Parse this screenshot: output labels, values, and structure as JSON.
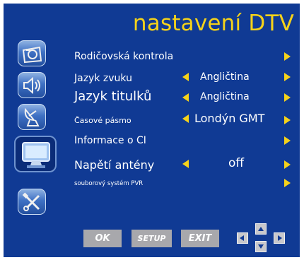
{
  "title": "nastavení DTV",
  "colors": {
    "panel": "#103a94",
    "accent": "#f5d21a",
    "text": "#ffffff",
    "button": "#a8a8ac"
  },
  "sidebar": {
    "icons": [
      "camera-icon",
      "speaker-icon",
      "satellite-icon",
      "tv-monitor-icon",
      "tools-icon"
    ],
    "selected": "tv-monitor-icon"
  },
  "menu": {
    "parental": {
      "label": "Rodičovská kontrola"
    },
    "audio_language": {
      "label": "Jazyk zvuku",
      "value": "Angličtina"
    },
    "subtitle_language": {
      "label": "Jazyk titulků",
      "value": "Angličtina"
    },
    "time_zone": {
      "label": "Časové pásmo",
      "value": "Londýn GMT"
    },
    "ci_info": {
      "label": "Informace o CI"
    },
    "antenna_power": {
      "label": "Napětí antény",
      "value": "off"
    },
    "pvr_filesystem": {
      "label": "souborový systém PVR"
    }
  },
  "buttons": {
    "ok": "OK",
    "setup": "SETUP",
    "exit": "EXIT"
  }
}
